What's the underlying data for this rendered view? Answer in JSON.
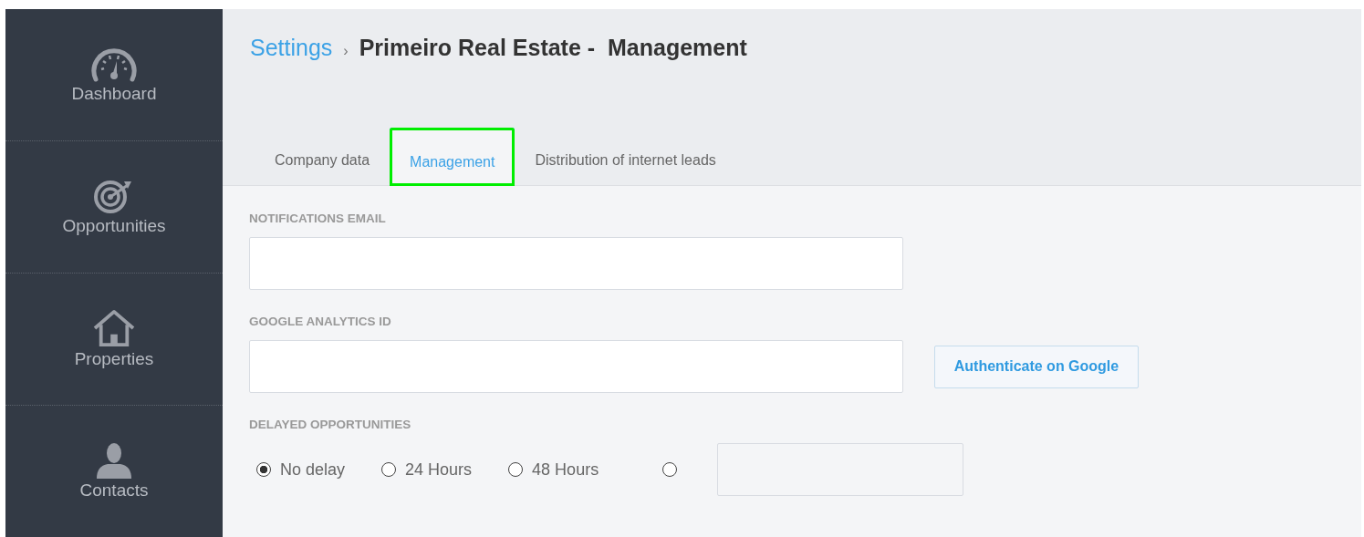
{
  "sidebar": {
    "items": [
      {
        "label": "Dashboard",
        "kind": "gauge"
      },
      {
        "label": "Opportunities",
        "kind": "target"
      },
      {
        "label": "Properties",
        "kind": "house"
      },
      {
        "label": "Contacts",
        "kind": "person"
      }
    ]
  },
  "breadcrumb": {
    "link": "Settings",
    "separator": "›",
    "current": "Primeiro Real Estate -  Management"
  },
  "tabs": [
    {
      "label": "Company data",
      "selected": false,
      "highlighted": false
    },
    {
      "label": "Management",
      "selected": true,
      "highlighted": true
    },
    {
      "label": "Distribution of internet leads",
      "selected": false,
      "highlighted": false
    }
  ],
  "form": {
    "notifications_email": {
      "label": "NOTIFICATIONS EMAIL"
    },
    "google_analytics_id": {
      "label": "GOOGLE ANALYTICS ID",
      "button": "Authenticate on Google"
    },
    "delayed_opportunities": {
      "label": "DELAYED OPPORTUNITIES",
      "options": [
        {
          "kind": "text",
          "label": "No delay",
          "selected": true
        },
        {
          "kind": "text",
          "label": "24 Hours",
          "selected": false
        },
        {
          "kind": "text",
          "label": "48 Hours",
          "selected": false
        },
        {
          "kind": "custom",
          "selected": false
        }
      ]
    }
  }
}
